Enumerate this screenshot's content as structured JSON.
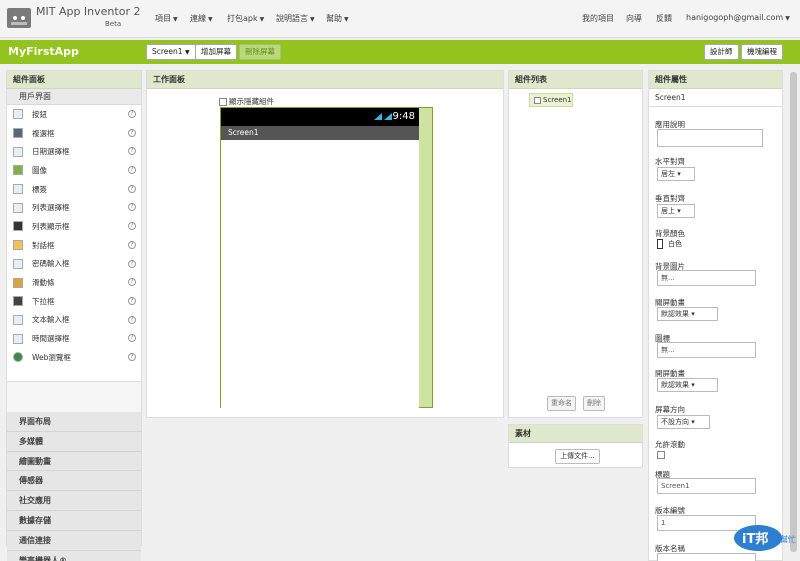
{
  "header": {
    "title": "MIT App Inventor 2",
    "beta": "Beta",
    "menus": [
      "項目",
      "連線",
      "打包apk",
      "說明語言",
      "幫助"
    ],
    "right_links": [
      "我的項目",
      "向導",
      "反饋"
    ],
    "user": "hanigogoph@gmail.com"
  },
  "toolbar": {
    "app_name": "MyFirstApp",
    "screen_select": "Screen1",
    "add_screen": "增加屏幕",
    "delete_screen": "刪除屏幕",
    "designer": "設計師",
    "blocks": "機塊編程"
  },
  "palette": {
    "title": "組件面板",
    "section": "用戶界面",
    "items": [
      "按鈕",
      "複選框",
      "日期選擇框",
      "圖像",
      "標簽",
      "列表選擇框",
      "列表顯示框",
      "對話框",
      "密碼輸入框",
      "滑動條",
      "下拉框",
      "文本輸入框",
      "時間選擇框",
      "Web瀏覽框"
    ],
    "categories": [
      "界面布局",
      "多媒體",
      "繪圖動畫",
      "傳感器",
      "社交應用",
      "數據存儲",
      "通信連接",
      "樂高機器人®"
    ]
  },
  "viewer": {
    "title": "工作面板",
    "show_hidden": "顯示隱藏組件",
    "time": "9:48",
    "screen_title": "Screen1"
  },
  "components": {
    "title": "組件列表",
    "root": "Screen1",
    "rename": "重命名",
    "delete": "刪除"
  },
  "media": {
    "title": "素材",
    "upload": "上傳文件..."
  },
  "properties": {
    "title": "組件屬性",
    "selected": "Screen1",
    "about_label": "應用說明",
    "align_h_label": "水平對齊",
    "align_h_value": "居左",
    "align_v_label": "垂直對齊",
    "align_v_value": "居上",
    "bg_color_label": "背景顏色",
    "bg_color_value": "白色",
    "bg_image_label": "背景圖片",
    "bg_image_value": "無...",
    "close_anim_label": "關屏動畫",
    "close_anim_value": "默認效果",
    "icon_label": "圖標",
    "icon_value": "無...",
    "open_anim_label": "開屏動畫",
    "open_anim_value": "默認效果",
    "orientation_label": "屏幕方向",
    "orientation_value": "不設方向",
    "scrollable_label": "允許滾動",
    "title_label": "標題",
    "title_value": "Screen1",
    "version_code_label": "版本編號",
    "version_code_value": "1",
    "version_name_label": "版本名稱"
  },
  "watermark": {
    "text": "iT邦",
    "sub": "幫忙"
  },
  "colors": {
    "accent": "#92c31e",
    "panel_head": "#dfe8cc"
  }
}
